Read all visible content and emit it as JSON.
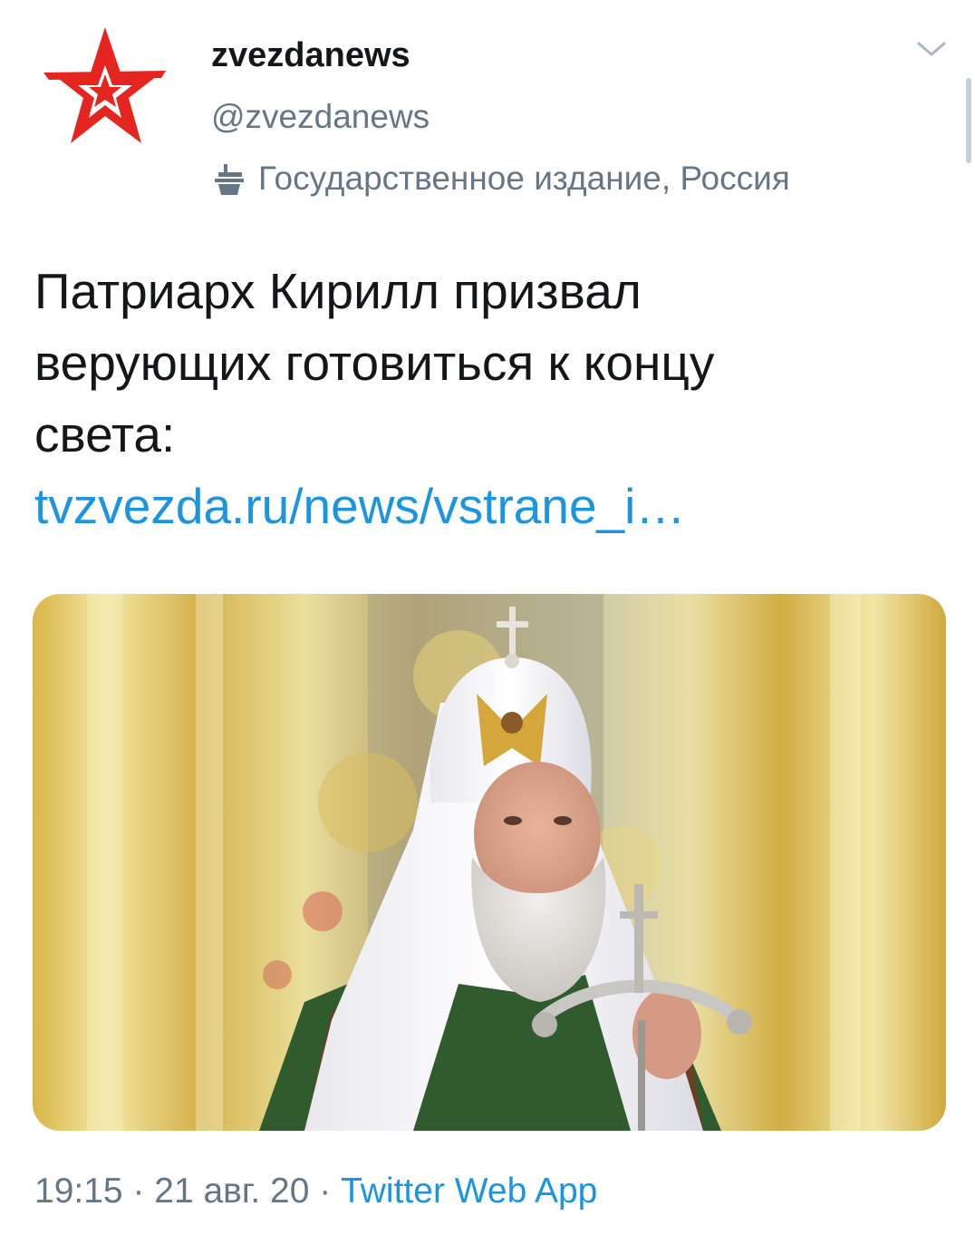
{
  "account": {
    "display_name": "zvezdanews",
    "handle": "@zvezdanews",
    "label": "Государственное издание, Россия",
    "label_icon": "podium-icon",
    "avatar_icon": "red-star-icon"
  },
  "tweet": {
    "text_lines": [
      "Патриарх Кирилл призвал",
      "верующих готовиться к концу",
      "света:"
    ],
    "link_text": "tvzvezda.ru/news/vstrane_i…"
  },
  "media": {
    "kind": "photo"
  },
  "footer": {
    "time": "19:15",
    "sep1": " · ",
    "date": "21 авг. 20",
    "sep2": " · ",
    "source": "Twitter Web App"
  },
  "colors": {
    "link": "#1b95e0",
    "secondary_text": "#657786",
    "primary_text": "#14171a",
    "brand_red": "#e5251f"
  }
}
